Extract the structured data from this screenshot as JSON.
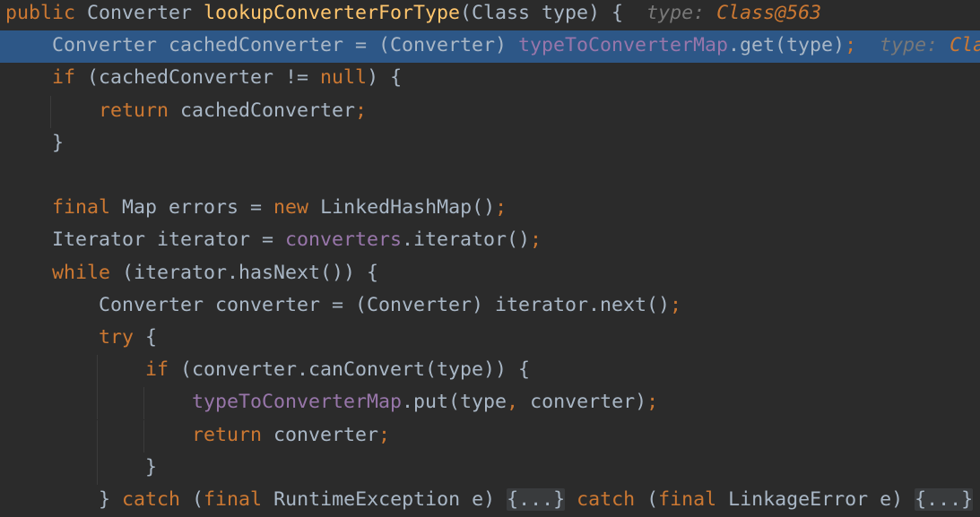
{
  "editor": {
    "lines": [
      {
        "tokens": [
          {
            "t": "public ",
            "c": "kw"
          },
          {
            "t": "Converter "
          },
          {
            "t": "lookupConverterForType",
            "c": "fn"
          },
          {
            "t": "(Class type) {  "
          },
          {
            "t": "type: ",
            "c": "hint-label",
            "name": "inline-hint-label"
          },
          {
            "t": "Class@563",
            "c": "hint-val",
            "name": "inline-hint-value"
          }
        ]
      },
      {
        "hl": true,
        "tokens": [
          {
            "t": "    Converter cachedConverter = (Converter) "
          },
          {
            "t": "typeToConverterMap",
            "c": "fld"
          },
          {
            "t": ".get(type)"
          },
          {
            "t": ";",
            "c": "kw"
          },
          {
            "t": "  "
          },
          {
            "t": "type: ",
            "c": "hint-label",
            "name": "inline-hint-label"
          },
          {
            "t": "Cla",
            "c": "hint-val",
            "name": "inline-hint-value"
          }
        ]
      },
      {
        "tokens": [
          {
            "t": "    "
          },
          {
            "t": "if",
            "c": "kw"
          },
          {
            "t": " (cachedConverter != "
          },
          {
            "t": "null",
            "c": "kw"
          },
          {
            "t": ") {"
          }
        ]
      },
      {
        "guides": [
          1
        ],
        "tokens": [
          {
            "t": "        "
          },
          {
            "t": "return",
            "c": "kw"
          },
          {
            "t": " cachedConverter"
          },
          {
            "t": ";",
            "c": "kw"
          }
        ]
      },
      {
        "tokens": [
          {
            "t": "    }"
          }
        ]
      },
      {
        "tokens": []
      },
      {
        "tokens": [
          {
            "t": "    "
          },
          {
            "t": "final",
            "c": "kw"
          },
          {
            "t": " Map errors = "
          },
          {
            "t": "new",
            "c": "kw"
          },
          {
            "t": " LinkedHashMap()"
          },
          {
            "t": ";",
            "c": "kw"
          }
        ]
      },
      {
        "tokens": [
          {
            "t": "    Iterator iterator = "
          },
          {
            "t": "converters",
            "c": "fld"
          },
          {
            "t": ".iterator()"
          },
          {
            "t": ";",
            "c": "kw"
          }
        ]
      },
      {
        "tokens": [
          {
            "t": "    "
          },
          {
            "t": "while",
            "c": "kw"
          },
          {
            "t": " (iterator.hasNext()) {"
          }
        ]
      },
      {
        "tokens": [
          {
            "t": "        Converter converter = (Converter) iterator.next()"
          },
          {
            "t": ";",
            "c": "kw"
          }
        ]
      },
      {
        "tokens": [
          {
            "t": "        "
          },
          {
            "t": "try",
            "c": "kw"
          },
          {
            "t": " {"
          }
        ]
      },
      {
        "guides": [
          2
        ],
        "tokens": [
          {
            "t": "            "
          },
          {
            "t": "if",
            "c": "kw"
          },
          {
            "t": " (converter.canConvert(type)) {"
          }
        ]
      },
      {
        "guides": [
          2,
          3
        ],
        "tokens": [
          {
            "t": "                "
          },
          {
            "t": "typeToConverterMap",
            "c": "fld"
          },
          {
            "t": ".put(type"
          },
          {
            "t": ",",
            "c": "kw"
          },
          {
            "t": " converter)"
          },
          {
            "t": ";",
            "c": "kw"
          }
        ]
      },
      {
        "guides": [
          2,
          3
        ],
        "tokens": [
          {
            "t": "                "
          },
          {
            "t": "return",
            "c": "kw"
          },
          {
            "t": " converter"
          },
          {
            "t": ";",
            "c": "kw"
          }
        ]
      },
      {
        "guides": [
          2
        ],
        "tokens": [
          {
            "t": "            }"
          }
        ]
      },
      {
        "tokens": [
          {
            "t": "        } "
          },
          {
            "t": "catch",
            "c": "kw"
          },
          {
            "t": " ("
          },
          {
            "t": "final",
            "c": "kw"
          },
          {
            "t": " RuntimeException e) "
          },
          {
            "t": "{...}",
            "c": "fold",
            "name": "folded-code-block",
            "interactable": true
          },
          {
            "t": " "
          },
          {
            "t": "catch",
            "c": "kw"
          },
          {
            "t": " ("
          },
          {
            "t": "final",
            "c": "kw"
          },
          {
            "t": " LinkageError e) "
          },
          {
            "t": "{...}",
            "c": "fold",
            "name": "folded-code-block",
            "interactable": true
          }
        ]
      }
    ]
  }
}
